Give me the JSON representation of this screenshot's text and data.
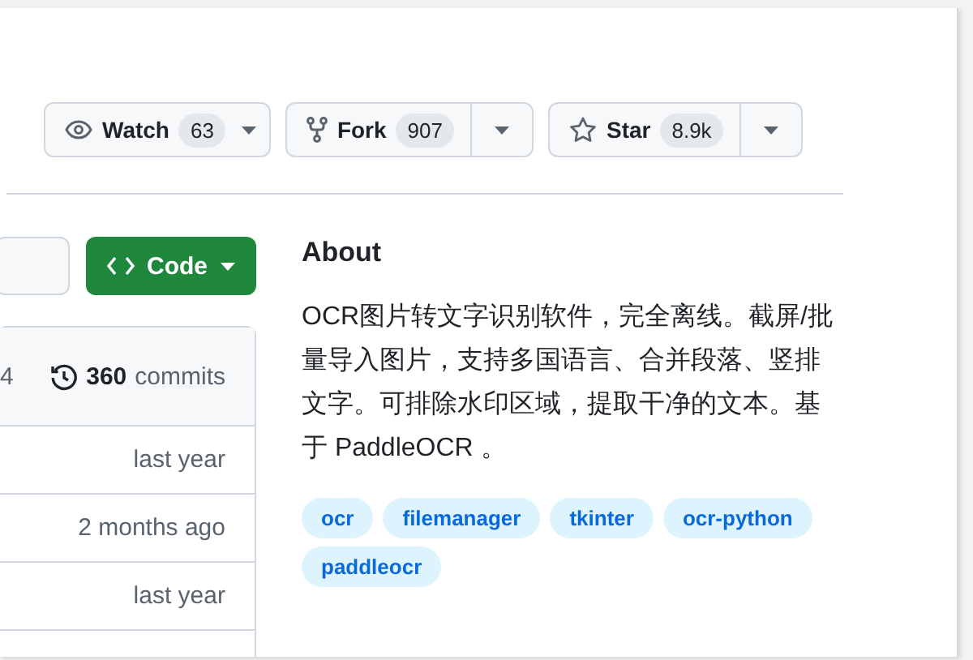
{
  "actions": [
    {
      "kind": "watch",
      "label": "Watch",
      "count": "63",
      "split": false
    },
    {
      "kind": "fork",
      "label": "Fork",
      "count": "907",
      "split": true
    },
    {
      "kind": "star",
      "label": "Star",
      "count": "8.9k",
      "split": true
    }
  ],
  "code_button": {
    "label": "Code"
  },
  "commits": {
    "cut_text": "4",
    "count": "360",
    "label": "commits"
  },
  "file_rows": [
    {
      "time": "last year"
    },
    {
      "time": "2 months ago"
    },
    {
      "time": "last year"
    }
  ],
  "about": {
    "title": "About",
    "description": "OCR图片转文字识别软件，完全离线。截屏/批量导入图片，支持多国语言、合并段落、竖排文字。可排除水印区域，提取干净的文本。基于 PaddleOCR 。",
    "topics": [
      "ocr",
      "filemanager",
      "tkinter",
      "ocr-python",
      "paddleocr"
    ]
  }
}
